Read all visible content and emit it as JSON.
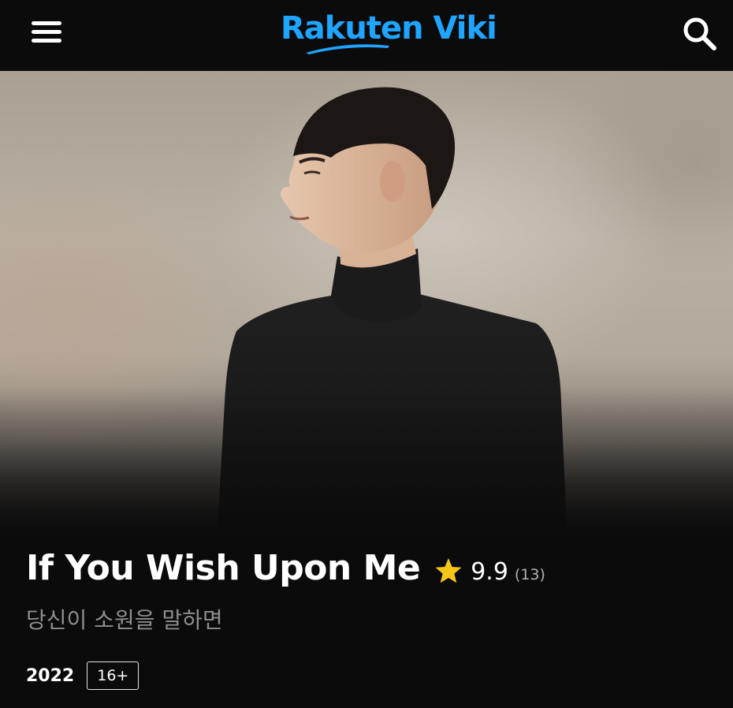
{
  "header": {
    "brand": "Rakuten Viki",
    "menu_icon": "hamburger-menu-icon",
    "search_icon": "search-icon",
    "brand_color": "#1fa4ff"
  },
  "hero": {
    "image_description_icon": "hero-poster-image"
  },
  "show": {
    "title": "If You Wish Upon Me",
    "rating_score": "9.9",
    "rating_count": "(13)",
    "rating_icon": "star-icon",
    "star_color": "#f5c518",
    "native_title": "당신이 소원을 말하면",
    "year": "2022",
    "age_rating": "16+"
  }
}
